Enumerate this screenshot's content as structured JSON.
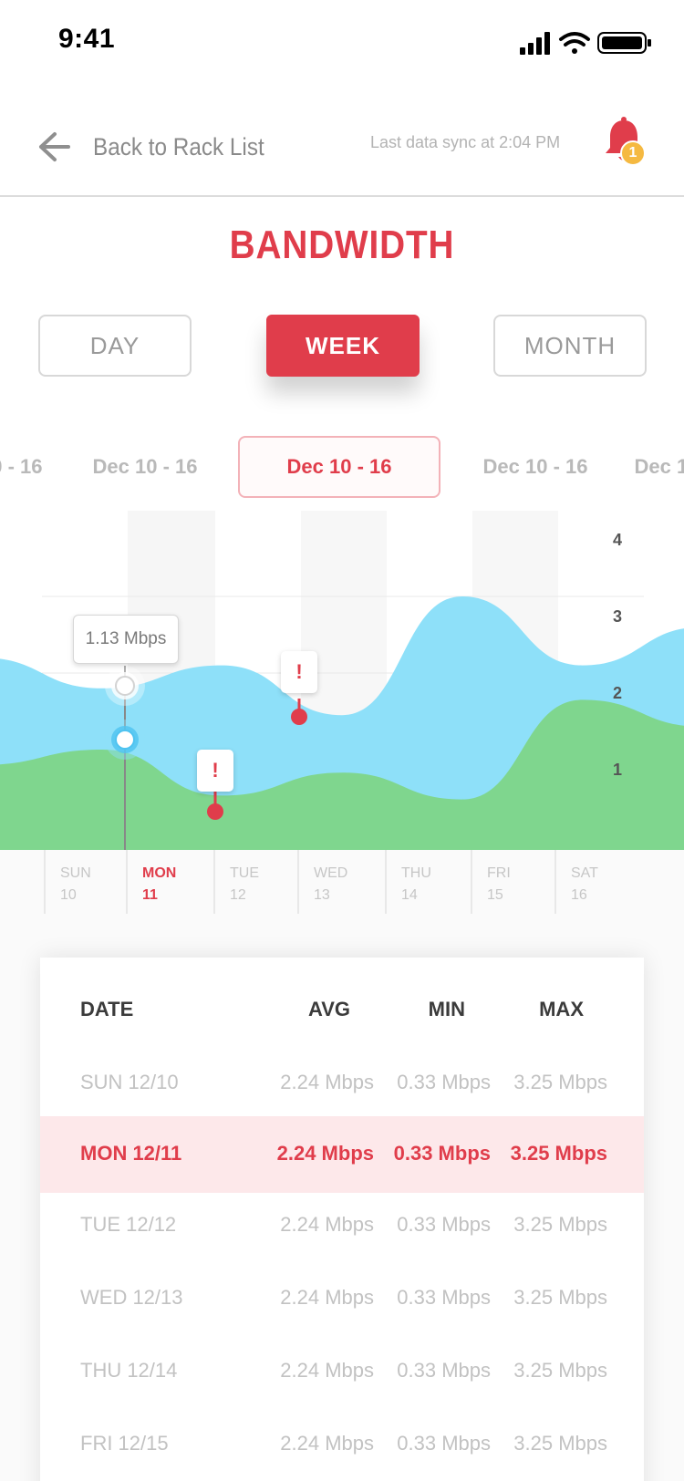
{
  "status_bar": {
    "time": "9:41"
  },
  "header": {
    "back_label": "Back to Rack List",
    "sync_text": "Last data sync at 2:04 PM",
    "notification_count": "1",
    "accent_color": "#e03d4b",
    "badge_color": "#f5b941"
  },
  "title": "BANDWIDTH",
  "range_tabs": [
    {
      "label": "DAY",
      "active": false
    },
    {
      "label": "WEEK",
      "active": true
    },
    {
      "label": "MONTH",
      "active": false
    }
  ],
  "weeks": [
    {
      "label": "Dec 10 - 16"
    },
    {
      "label": "Dec 10 - 16"
    },
    {
      "label": "Dec 10 - 16",
      "active": true
    },
    {
      "label": "Dec 10 - 16"
    },
    {
      "label": "Dec 10 - 16"
    }
  ],
  "chart": {
    "tooltip": "1.13 Mbps",
    "alert_glyph": "!",
    "y_ticks": [
      "4",
      "3",
      "2",
      "1"
    ]
  },
  "chart_data": {
    "type": "area",
    "x": [
      "SUN 10",
      "MON 11",
      "TUE 12",
      "WED 13",
      "THU 14",
      "FRI 15",
      "SAT 16"
    ],
    "ylim": [
      0,
      4
    ],
    "series": [
      {
        "values": [
          2.2,
          1.8,
          2.1,
          1.45,
          3.0,
          2.1,
          2.6
        ],
        "color": "#8ee0f9"
      },
      {
        "values": [
          0.8,
          1.0,
          0.4,
          0.7,
          0.35,
          1.65,
          1.3
        ],
        "color": "#7fd68e"
      }
    ]
  },
  "days": [
    {
      "name": "SUN",
      "num": "10"
    },
    {
      "name": "MON",
      "num": "11",
      "active": true
    },
    {
      "name": "TUE",
      "num": "12"
    },
    {
      "name": "WED",
      "num": "13"
    },
    {
      "name": "THU",
      "num": "14"
    },
    {
      "name": "FRI",
      "num": "15"
    },
    {
      "name": "SAT",
      "num": "16"
    }
  ],
  "table": {
    "headers": {
      "date": "DATE",
      "avg": "AVG",
      "min": "MIN",
      "max": "MAX"
    },
    "rows": [
      {
        "date": "SUN 12/10",
        "avg": "2.24 Mbps",
        "min": "0.33 Mbps",
        "max": "3.25 Mbps"
      },
      {
        "date": "MON 12/11",
        "avg": "2.24 Mbps",
        "min": "0.33 Mbps",
        "max": "3.25 Mbps",
        "active": true
      },
      {
        "date": "TUE 12/12",
        "avg": "2.24 Mbps",
        "min": "0.33 Mbps",
        "max": "3.25 Mbps"
      },
      {
        "date": "WED 12/13",
        "avg": "2.24 Mbps",
        "min": "0.33 Mbps",
        "max": "3.25 Mbps"
      },
      {
        "date": "THU 12/14",
        "avg": "2.24 Mbps",
        "min": "0.33 Mbps",
        "max": "3.25 Mbps"
      },
      {
        "date": "FRI 12/15",
        "avg": "2.24 Mbps",
        "min": "0.33 Mbps",
        "max": "3.25 Mbps"
      }
    ]
  }
}
